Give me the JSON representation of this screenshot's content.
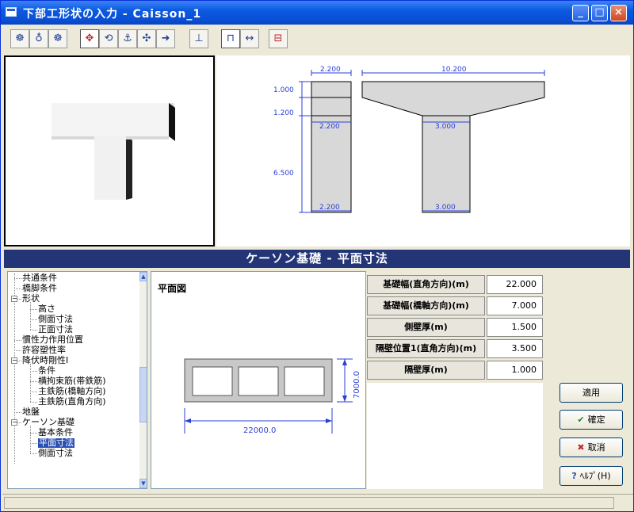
{
  "window": {
    "title": "下部工形状の入力 - Caisson_1",
    "min_label": "_",
    "max_label": "□",
    "close_label": "×"
  },
  "toolbar": {
    "icons": [
      "camera-icon",
      "bulb-icon",
      "camera2-icon",
      "move-icon",
      "rotate-icon",
      "anchor-icon",
      "pan-icon",
      "arrow-icon",
      "bridge-icon",
      "pier-icon",
      "dimension-icon",
      "section-icon"
    ]
  },
  "drawing": {
    "left_width": "2.200",
    "right_width": "10.200",
    "h1": "1.000",
    "h2": "1.200",
    "h3": "6.500",
    "left_col_top": "2.200",
    "left_col_bottom": "2.200",
    "right_col_top": "3.000",
    "right_col_bottom": "3.000"
  },
  "section_title": "ケーソン基礎 - 平面寸法",
  "tree": {
    "items": [
      {
        "label": "共通条件",
        "level": 1
      },
      {
        "label": "橋脚条件",
        "level": 1
      },
      {
        "label": "形状",
        "level": 1
      },
      {
        "label": "高さ",
        "level": 2
      },
      {
        "label": "側面寸法",
        "level": 2
      },
      {
        "label": "正面寸法",
        "level": 2
      },
      {
        "label": "慣性力作用位置",
        "level": 1
      },
      {
        "label": "許容塑性率",
        "level": 1
      },
      {
        "label": "降伏時剛性I",
        "level": 1
      },
      {
        "label": "条件",
        "level": 2
      },
      {
        "label": "横拘束筋(帯鉄筋)",
        "level": 2
      },
      {
        "label": "主鉄筋(橋軸方向)",
        "level": 2
      },
      {
        "label": "主鉄筋(直角方向)",
        "level": 2
      },
      {
        "label": "地盤",
        "level": 1
      },
      {
        "label": "ケーソン基礎",
        "level": 1
      },
      {
        "label": "基本条件",
        "level": 2
      },
      {
        "label": "平面寸法",
        "level": 2
      },
      {
        "label": "側面寸法",
        "level": 2
      }
    ]
  },
  "plan": {
    "label": "平面図",
    "width_dim": "22000.0",
    "height_dim": "7000.0"
  },
  "table": {
    "rows": [
      {
        "label": "基礎幅(直角方向)(m)",
        "value": "22.000"
      },
      {
        "label": "基礎幅(橋軸方向)(m)",
        "value": "7.000"
      },
      {
        "label": "側壁厚(m)",
        "value": "1.500"
      },
      {
        "label": "隔壁位置1(直角方向)(m)",
        "value": "3.500"
      },
      {
        "label": "隔壁厚(m)",
        "value": "1.000"
      }
    ]
  },
  "buttons": {
    "apply": "適用",
    "ok": "確定",
    "cancel": "取消",
    "help": "ﾍﾙﾌﾟ(H)"
  }
}
